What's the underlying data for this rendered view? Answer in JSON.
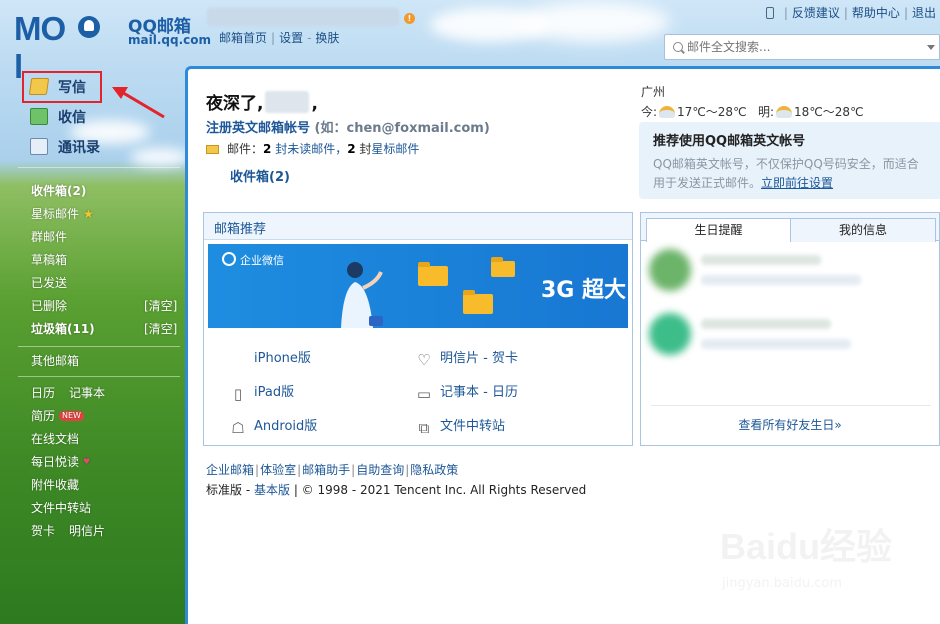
{
  "header": {
    "logo_mark": "MO l",
    "logo_title": "QQ邮箱",
    "logo_domain": "mail.qq.com",
    "top_links": [
      "邮箱首页",
      "设置",
      "换肤"
    ],
    "right_links": [
      "反馈建议",
      "帮助中心",
      "退出"
    ],
    "search_placeholder": "邮件全文搜索..."
  },
  "sidebar": {
    "actions": [
      {
        "label": "写信",
        "icon": "pencil-icon"
      },
      {
        "label": "收信",
        "icon": "inbox-download-icon"
      },
      {
        "label": "通讯录",
        "icon": "contacts-icon"
      }
    ],
    "folders": {
      "inbox": "收件箱(2)",
      "starred": "星标邮件",
      "group": "群邮件",
      "drafts": "草稿箱",
      "sent": "已发送",
      "deleted": "已删除",
      "spam": "垃圾箱(11)",
      "clear": "[清空]",
      "other": "其他邮箱"
    },
    "tools": {
      "calendar": "日历",
      "notepad": "记事本",
      "resume": "简历",
      "new_badge": "NEW",
      "docs": "在线文档",
      "daily": "每日悦读",
      "attachments": "附件收藏",
      "transfer": "文件中转站",
      "card": "贺卡",
      "postcard": "明信片"
    }
  },
  "main": {
    "greeting_prefix": "夜深了,",
    "greeting_suffix": ",",
    "register_link": "注册英文邮箱帐号",
    "register_hint": "(如：chen@foxmail.com)",
    "mail_label": "邮件：",
    "unread_count": "2",
    "unread_text": "封未读邮件，",
    "star_count": "2",
    "star_prefix": "封",
    "star_link": "星标邮件",
    "inbox_link": "收件箱(2)"
  },
  "weather": {
    "city": "广州",
    "today_label": "今:",
    "today_temp": "17℃～28℃",
    "tomorrow_label": "明:",
    "tomorrow_temp": "18℃～28℃"
  },
  "promo": {
    "title": "推荐使用QQ邮箱英文帐号",
    "desc": "QQ邮箱英文帐号，不仅保护QQ号码安全，而适合用于发送正式邮件。",
    "link": "立即前往设置"
  },
  "recommend": {
    "title": "邮箱推荐",
    "banner_brand": "企业微信",
    "banner_text": "3G 超大",
    "items": {
      "iphone": "iPhone版",
      "ipad": "iPad版",
      "android": "Android版",
      "postcard": "明信片 - 贺卡",
      "notepad": "记事本 - 日历",
      "transfer": "文件中转站"
    }
  },
  "birthday": {
    "tab1": "生日提醒",
    "tab2": "我的信息",
    "see_all": "查看所有好友生日»"
  },
  "footer": {
    "links": [
      "企业邮箱",
      "体验室",
      "邮箱助手",
      "自助查询",
      "隐私政策"
    ],
    "std": "标准版",
    "basic": "基本版",
    "copyright": "© 1998 - 2021 Tencent Inc. All Rights Reserved"
  },
  "watermark": {
    "main": "Baidu经验",
    "sub": "jingyan.baidu.com"
  },
  "colors": {
    "accent": "#2f8ad8",
    "link": "#1d5797",
    "highlight_box": "#e3242b"
  }
}
